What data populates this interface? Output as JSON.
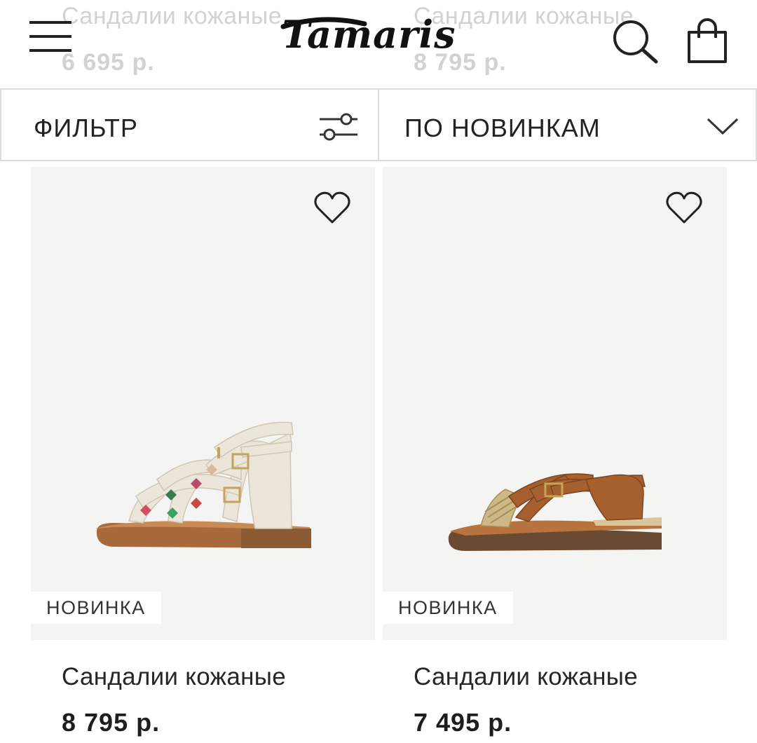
{
  "header": {
    "brand": "Tamaris",
    "menu_icon": "hamburger-menu-icon",
    "search_icon": "search-icon",
    "bag_icon": "shopping-bag-icon"
  },
  "scrolled_products": [
    {
      "title": "Сандалии кожаные",
      "price": "6 695 р."
    },
    {
      "title": "Сандалии кожаные",
      "price": "8 795 р."
    }
  ],
  "toolbar": {
    "filter_label": "ФИЛЬТР",
    "filter_icon": "sliders-icon",
    "sort_label": "ПО НОВИНКАМ",
    "sort_icon": "chevron-down-icon"
  },
  "products": [
    {
      "title": "Сандалии кожаные",
      "price": "8 795 р.",
      "badge": "НОВИНКА",
      "favorite_icon": "heart-icon"
    },
    {
      "title": "Сандалии кожаные",
      "price": "7 495 р.",
      "badge": "НОВИНКА",
      "favorite_icon": "heart-icon"
    }
  ],
  "colors": {
    "text": "#1e1e1e",
    "photo_bg": "#f4f4f3",
    "border": "#dcdcdc",
    "faded_text": "#d2d2d2"
  }
}
